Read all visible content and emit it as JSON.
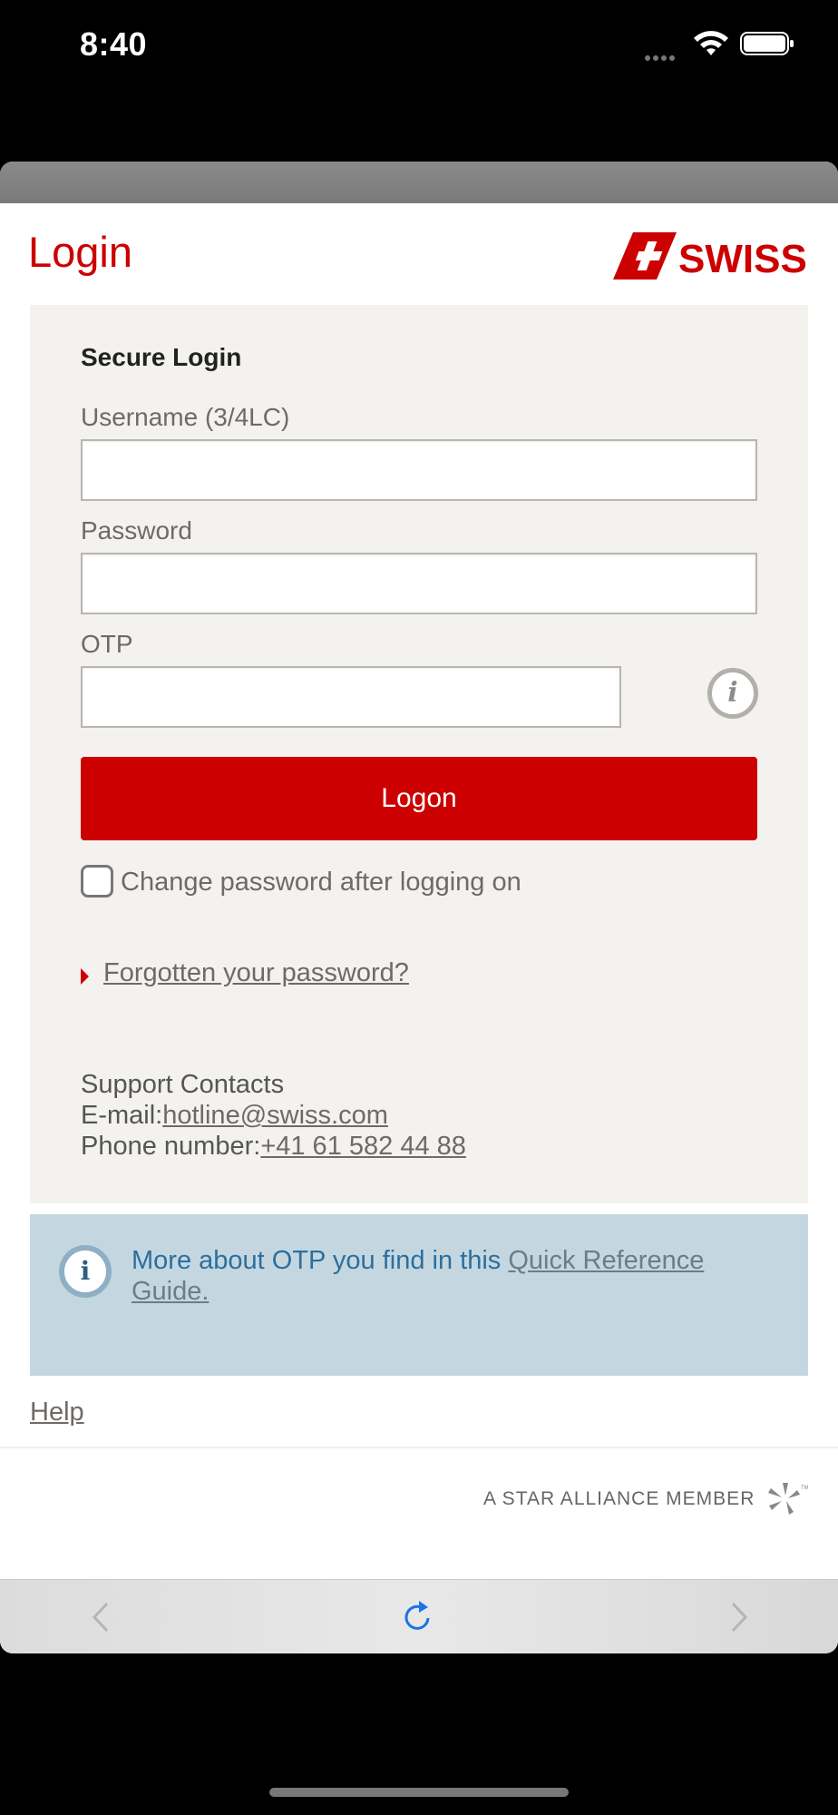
{
  "status_bar": {
    "time": "8:40"
  },
  "header": {
    "title": "Login",
    "logo_text": "SWISS"
  },
  "login": {
    "heading": "Secure Login",
    "username_label": "Username (3/4LC)",
    "username_value": "",
    "password_label": "Password",
    "password_value": "",
    "otp_label": "OTP",
    "otp_value": "",
    "logon_label": "Logon",
    "change_password_label": "Change password after logging on",
    "forgot_label": "Forgotten your password?"
  },
  "support": {
    "heading": "Support Contacts",
    "email_label": "E-mail:",
    "email_value": "hotline@swiss.com",
    "phone_label": "Phone number:",
    "phone_value": "+41 61 582 44 88"
  },
  "otp_info": {
    "text": "More about OTP you find in this ",
    "link": "Quick Reference Guide."
  },
  "footer": {
    "help_label": "Help",
    "alliance_text": "A STAR ALLIANCE MEMBER"
  },
  "colors": {
    "brand_red": "#cc0000",
    "panel_bg": "#f3f2ef",
    "info_bg": "#c4d7e1",
    "toolbar_accent": "#1a73e8"
  },
  "icons": [
    "wifi-icon",
    "battery-icon",
    "swiss-cross-icon",
    "info-icon",
    "back-icon",
    "reload-icon",
    "forward-icon",
    "star-alliance-icon"
  ]
}
